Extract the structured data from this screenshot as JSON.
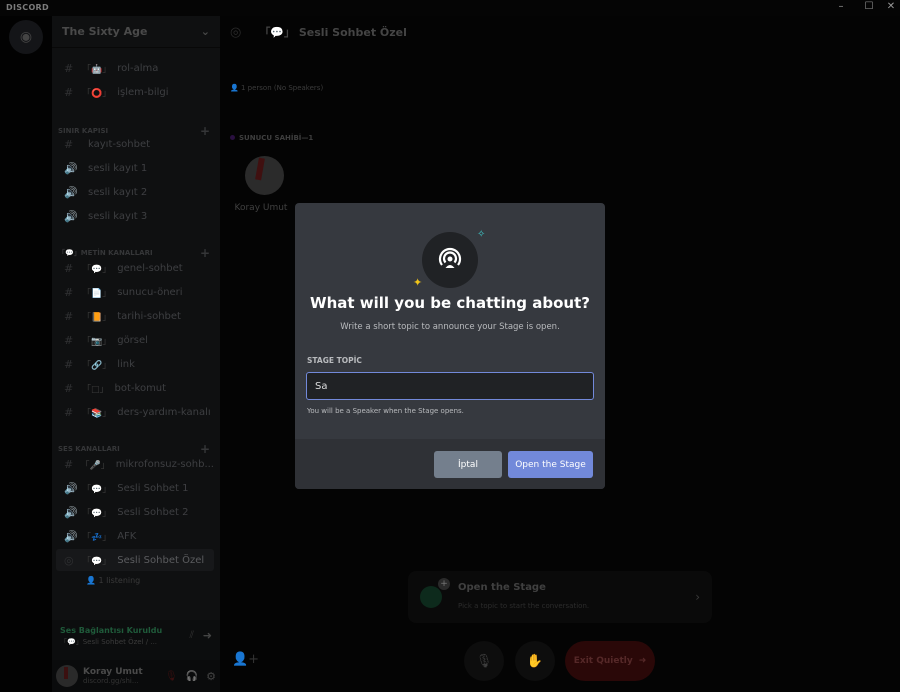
{
  "app": {
    "title": "DISCORD",
    "window_controls": [
      "–",
      "☐",
      "✕"
    ]
  },
  "server": {
    "name": "The Sixty Age"
  },
  "channels": [
    {
      "type": "text",
      "emoji": "「🤖」",
      "name": "rol-alma"
    },
    {
      "type": "text",
      "emoji": "「⭕」",
      "name": "işlem-bilgi"
    },
    {
      "category": "SINIR KAPISI"
    },
    {
      "type": "text",
      "emoji": "",
      "name": "kayıt-sohbet"
    },
    {
      "type": "voice",
      "emoji": "",
      "name": "sesli kayıt 1"
    },
    {
      "type": "voice",
      "emoji": "",
      "name": "sesli kayıt 2"
    },
    {
      "type": "voice",
      "emoji": "",
      "name": "sesli kayıt 3"
    },
    {
      "category": "「💬」METİN KANALLARI"
    },
    {
      "type": "text",
      "emoji": "「💬」",
      "name": "genel-sohbet"
    },
    {
      "type": "text",
      "emoji": "「📄」",
      "name": "sunucu-öneri"
    },
    {
      "type": "text",
      "emoji": "「📙」",
      "name": "tarihi-sohbet"
    },
    {
      "type": "text",
      "emoji": "「📷」",
      "name": "görsel"
    },
    {
      "type": "text",
      "emoji": "「🔗」",
      "name": "link"
    },
    {
      "type": "text",
      "emoji": "「□」",
      "name": "bot-komut"
    },
    {
      "type": "text",
      "emoji": "「📚」",
      "name": "ders-yardım-kanalı"
    },
    {
      "category": "SES KANALLARI"
    },
    {
      "type": "text",
      "emoji": "「🎤」",
      "name": "mikrofonsuz-sohb..."
    },
    {
      "type": "voice",
      "emoji": "「💬」",
      "name": "Sesli Sohbet 1"
    },
    {
      "type": "voice",
      "emoji": "「💬」",
      "name": "Sesli Sohbet 2"
    },
    {
      "type": "voice",
      "emoji": "「💤」",
      "name": "AFK"
    },
    {
      "type": "stage",
      "emoji": "「💬」",
      "name": "Sesli Sohbet Özel",
      "active": true
    }
  ],
  "listening": "1 listening",
  "voice": {
    "status": "Ses Bağlantısı Kuruldu",
    "channel": "「💬」Sesli Sohbet Özel / ..."
  },
  "user": {
    "name": "Koray Umut",
    "tag": "discord.gg/shi..."
  },
  "stage": {
    "title": "「💬」 Sesli Sohbet Özel",
    "people": "1 person (No Speakers)",
    "section": "SUNUCU SAHİBİ—1",
    "speaker": "Koray Umut"
  },
  "open_card": {
    "title": "Open the Stage",
    "subtitle": "Pick a topic to start the conversation."
  },
  "exit_label": "Exit Quietly",
  "modal": {
    "title": "What will you be chatting about?",
    "subtitle": "Write a short topic to announce your Stage is open.",
    "label": "STAGE TOPİC",
    "value": "Sa",
    "hint": "You will be a Speaker when the Stage opens.",
    "cancel": "İptal",
    "open": "Open the Stage"
  },
  "colors": {
    "accent": "#7289da",
    "modal_bg": "#36393f",
    "cancel": "#747f8d"
  }
}
